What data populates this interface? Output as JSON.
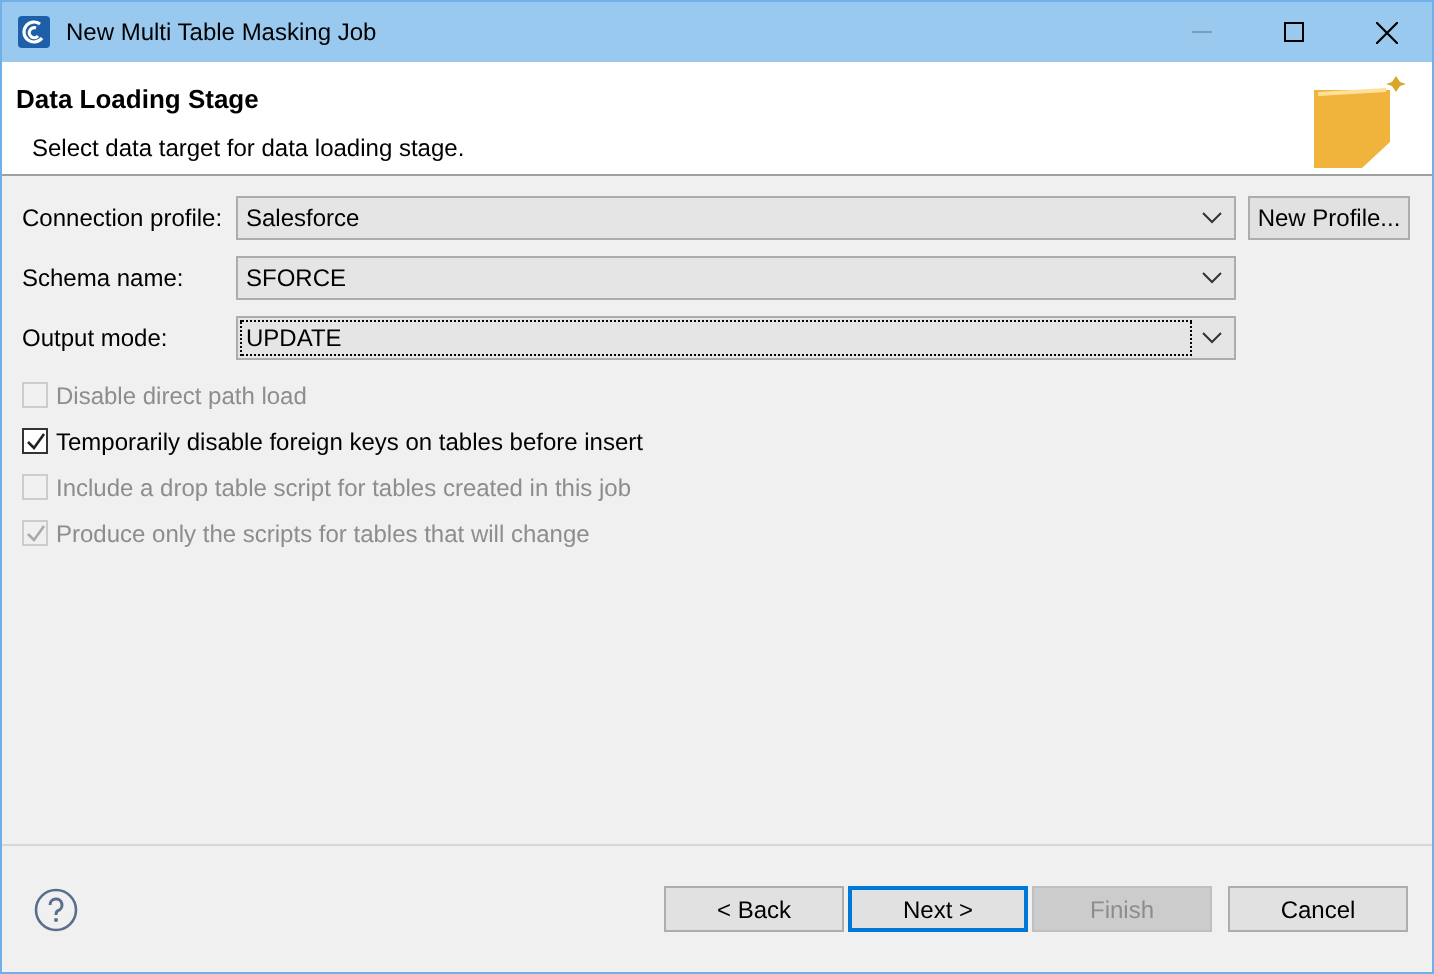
{
  "window": {
    "title": "New Multi Table Masking Job"
  },
  "header": {
    "title": "Data Loading Stage",
    "description": "Select data target for data loading stage."
  },
  "fields": [
    {
      "label": "Connection profile:",
      "value": "Salesforce",
      "focused": false,
      "button": "New Profile..."
    },
    {
      "label": "Schema name:",
      "value": "SFORCE",
      "focused": false
    },
    {
      "label": "Output mode:",
      "value": "UPDATE",
      "focused": true
    }
  ],
  "options": [
    {
      "label": "Disable direct path load",
      "checked": false,
      "disabled": true
    },
    {
      "label": "Temporarily disable foreign keys on tables before insert",
      "checked": true,
      "disabled": false
    },
    {
      "label": "Include a drop table script for tables created in this job",
      "checked": false,
      "disabled": true
    },
    {
      "label": "Produce only the scripts for tables that will change",
      "checked": true,
      "disabled": true
    }
  ],
  "buttons": [
    {
      "label": "< Back",
      "default": false,
      "disabled": false
    },
    {
      "label": "Next >",
      "default": true,
      "disabled": false
    },
    {
      "label": "Finish",
      "default": false,
      "disabled": true
    },
    {
      "label": "Cancel",
      "default": false,
      "disabled": false
    }
  ]
}
